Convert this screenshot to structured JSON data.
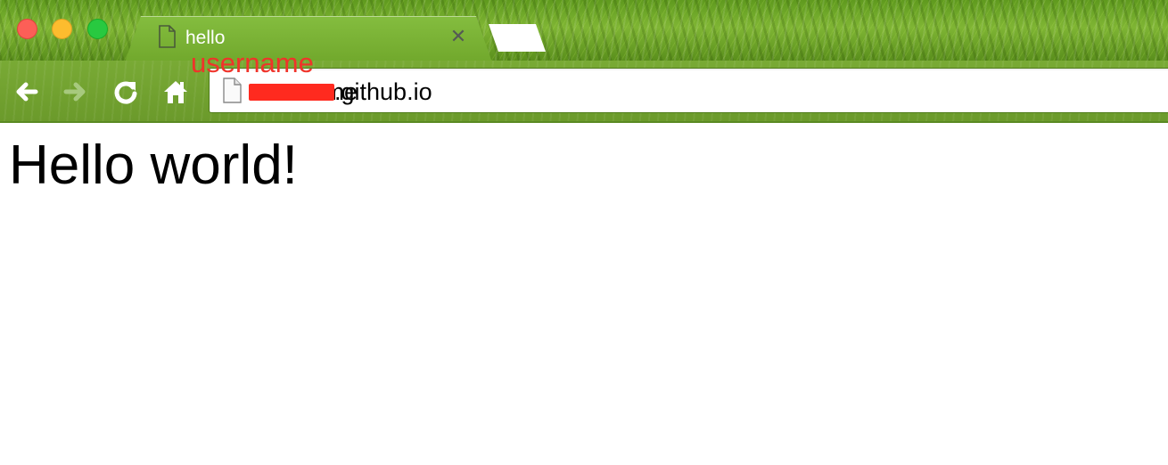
{
  "window": {
    "controls": [
      "close",
      "minimize",
      "maximize"
    ],
    "colors": {
      "close": "#fc5f57",
      "minimize": "#fdbc2e",
      "maximize": "#28c940"
    }
  },
  "tab": {
    "title": "hello",
    "icon": "page-icon",
    "close_icon": "close-icon",
    "close_glyph": "✕"
  },
  "new_tab": {
    "icon": "new-tab-button"
  },
  "toolbar": {
    "back_icon": "back-arrow-icon",
    "forward_icon": "forward-arrow-icon",
    "reload_icon": "reload-icon",
    "home_icon": "home-icon"
  },
  "address_bar": {
    "icon": "page-icon",
    "username_text": "username",
    "domain": ".github.io",
    "redaction_color": "#ff2a1f"
  },
  "annotation": {
    "text": "username",
    "color": "#f0332a"
  },
  "page": {
    "heading": "Hello world!"
  }
}
